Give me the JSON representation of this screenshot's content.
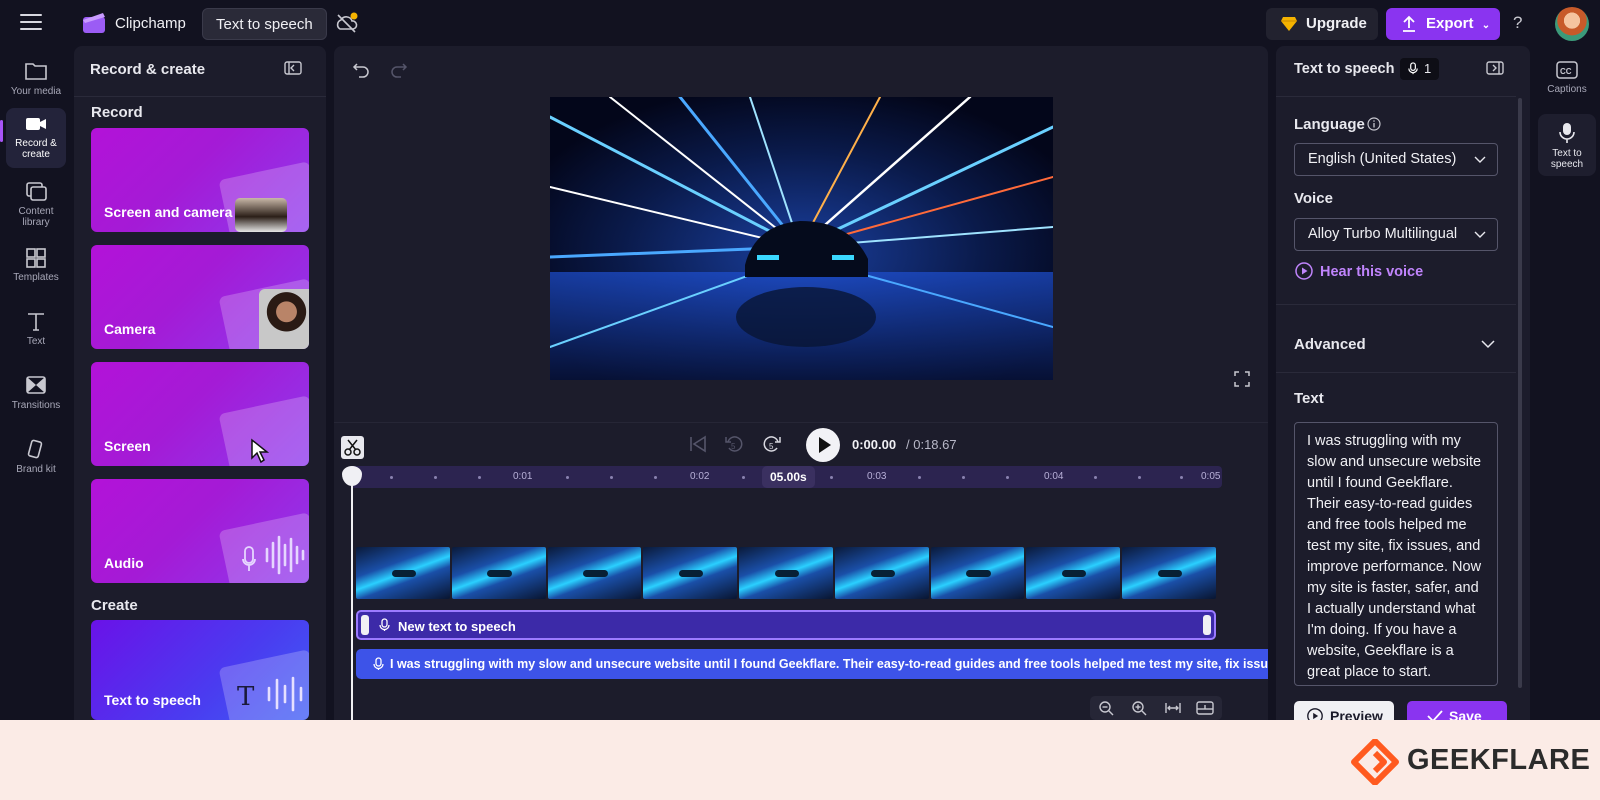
{
  "app": {
    "name": "Clipchamp",
    "project_title": "Text to speech"
  },
  "topbar": {
    "upgrade_label": "Upgrade",
    "export_label": "Export",
    "help_label": "?"
  },
  "rail": [
    {
      "label": "Your media",
      "icon": "folder-icon"
    },
    {
      "label": "Record & create",
      "icon": "camera-icon"
    },
    {
      "label": "Content library",
      "icon": "library-icon"
    },
    {
      "label": "Templates",
      "icon": "templates-icon"
    },
    {
      "label": "Text",
      "icon": "text-icon"
    },
    {
      "label": "Transitions",
      "icon": "transitions-icon"
    },
    {
      "label": "Brand kit",
      "icon": "brand-kit-icon"
    }
  ],
  "record_panel": {
    "title": "Record & create",
    "record_section": "Record",
    "create_section": "Create",
    "cards": [
      "Screen and camera",
      "Camera",
      "Screen",
      "Audio"
    ],
    "create_cards": [
      "Text to speech"
    ]
  },
  "player": {
    "time_current": "0:00.00",
    "time_total": "/ 0:18.67",
    "ruler_labels": [
      "0:01",
      "0:02",
      "0:03",
      "0:04",
      "0:05"
    ],
    "ruler_badge": "05.00s"
  },
  "timeline": {
    "tts_clip_label": "New text to speech",
    "caption_clip_text": "I was struggling with my slow and unsecure website until I found Geekflare. Their easy-to-read guides and free tools helped me test my site, fix issues, and improve performance."
  },
  "tts_panel": {
    "title": "Text to speech",
    "count": "1",
    "language_label": "Language",
    "language_value": "English (United States)",
    "voice_label": "Voice",
    "voice_value": "Alloy Turbo Multilingual",
    "hear_voice": "Hear this voice",
    "advanced_label": "Advanced",
    "text_label": "Text",
    "text_value": "I was struggling with my slow and unsecure website until I found Geekflare. Their easy-to-read guides and free tools helped me test my site, fix issues, and improve performance. Now my site is faster, safer, and I actually understand what I'm doing. If you have a website, Geekflare is a great place to start.",
    "preview_label": "Preview",
    "save_label": "Save"
  },
  "right_rail": [
    {
      "label": "Captions",
      "icon": "captions-icon"
    },
    {
      "label": "Text to speech",
      "icon": "text-to-speech-icon"
    }
  ],
  "watermark": {
    "text": "GEEKFLARE"
  },
  "colors": {
    "accent": "#8a34f0",
    "background": "#121220",
    "panel": "#1c1c2b",
    "link": "#c084fc",
    "caption_track": "#3d53e8"
  }
}
